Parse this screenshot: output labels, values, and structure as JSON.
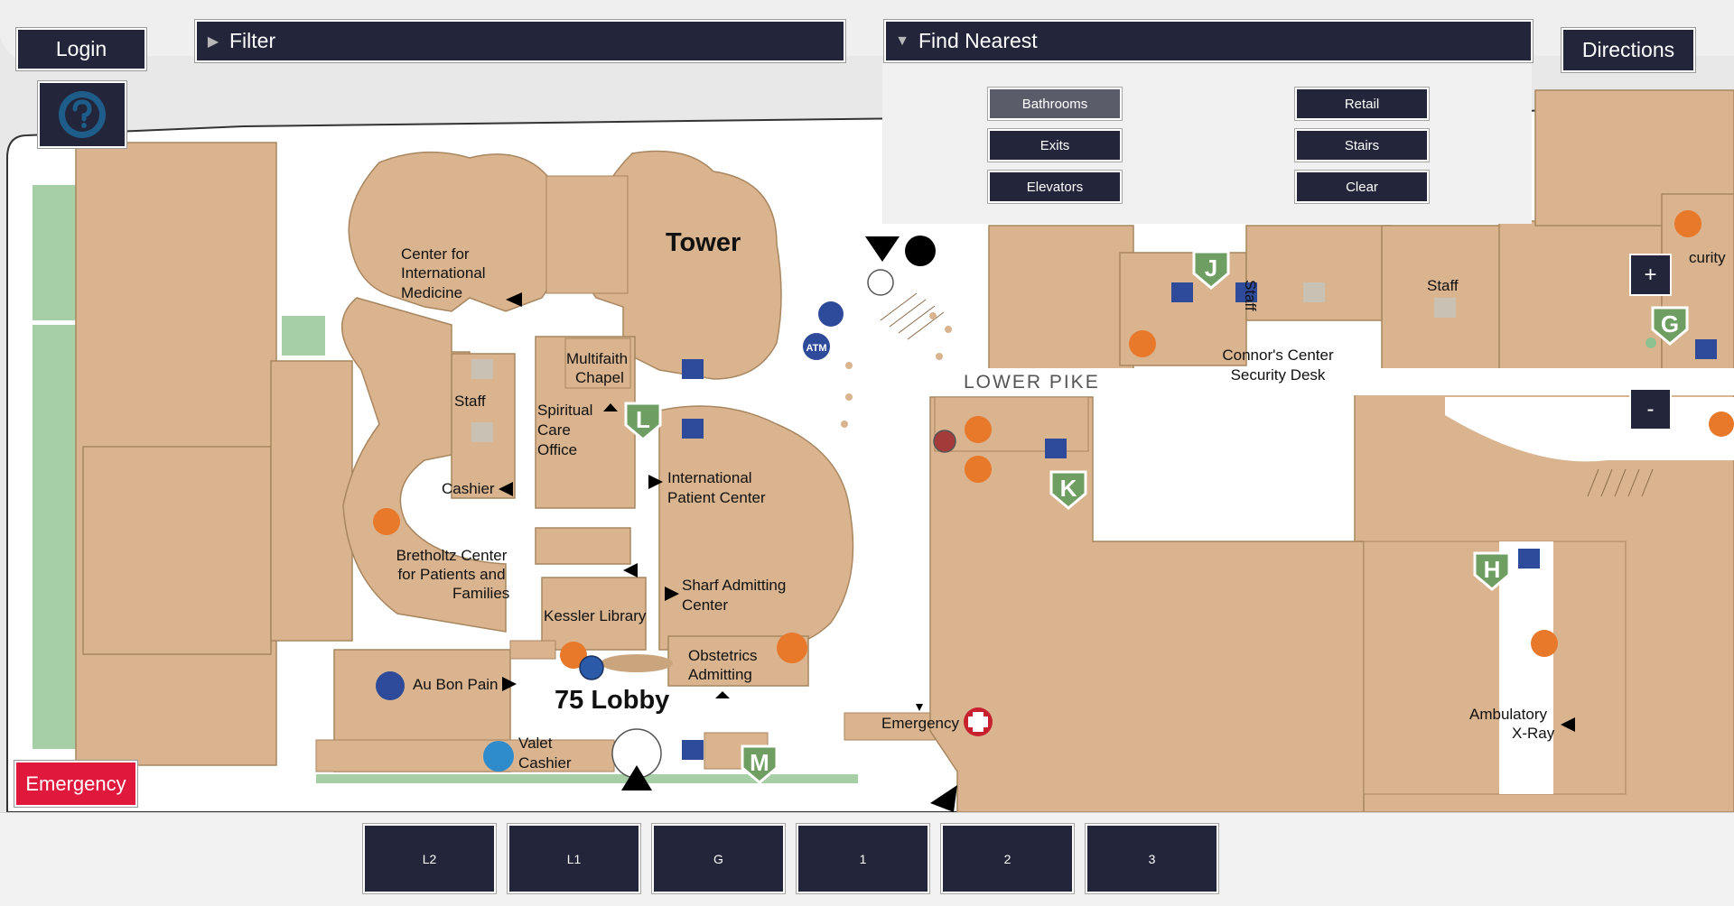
{
  "header": {
    "login_label": "Login",
    "filter_label": "Filter",
    "find_nearest_label": "Find Nearest",
    "directions_label": "Directions"
  },
  "find_nearest": {
    "options": [
      "Bathrooms",
      "Retail",
      "Exits",
      "Stairs",
      "Elevators",
      "Clear"
    ],
    "selected": "Bathrooms"
  },
  "zoom": {
    "in_label": "+",
    "out_label": "-"
  },
  "emergency_button_label": "Emergency",
  "floors": [
    "L2",
    "L1",
    "G",
    "1",
    "2",
    "3"
  ],
  "map": {
    "labels": {
      "tower": "Tower",
      "cim1": "Center for",
      "cim2": "International",
      "cim3": "Medicine",
      "chapel1": "Multifaith",
      "chapel2": "Chapel",
      "staff_left": "Staff",
      "spiritual1": "Spiritual",
      "spiritual2": "Care",
      "spiritual3": "Office",
      "cashier": "Cashier",
      "intl1": "International",
      "intl2": "Patient Center",
      "bret1": "Bretholtz Center",
      "bret2": "for Patients and",
      "bret3": "Families",
      "sharf1": "Sharf Admitting",
      "sharf2": "Center",
      "kessler": "Kessler Library",
      "obst1": "Obstetrics",
      "obst2": "Admitting",
      "lobby": "75 Lobby",
      "aubonpain": "Au Bon Pain",
      "valet1": "Valet",
      "valet2": "Cashier",
      "emergency": "Emergency",
      "lower_pike": "LOWER PIKE",
      "connors1": "Connor's Center",
      "connors2": "Security Desk",
      "staff_mid": "Staff",
      "staff_right": "Staff",
      "security": "curity",
      "xray1": "Ambulatory",
      "xray2": "X-Ray",
      "atm": "ATM"
    },
    "markers": [
      "J",
      "L",
      "K",
      "G",
      "H",
      "M"
    ],
    "colors": {
      "building": "#d9b48f",
      "building_stroke": "#a8865f",
      "marker_green": "#6e9e62",
      "amenity_orange": "#e8782a",
      "elevator_blue": "#2e4a9a",
      "ui_dark": "#23253a",
      "emergency_red": "#e0183c"
    }
  }
}
